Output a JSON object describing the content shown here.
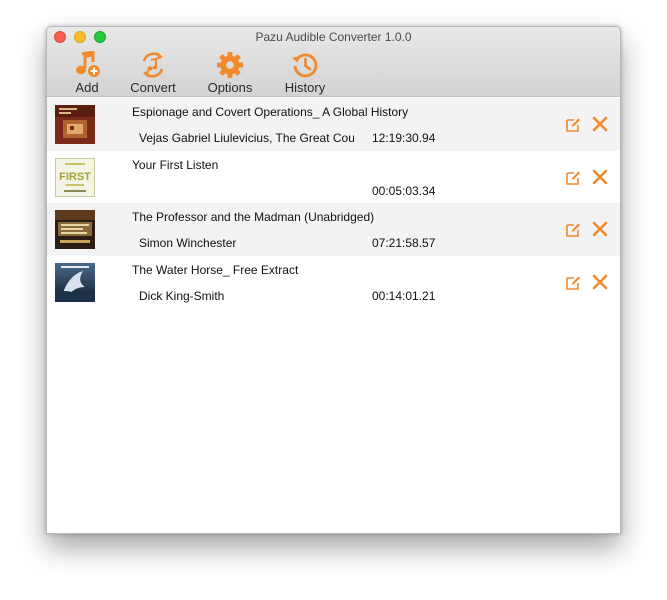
{
  "window": {
    "title": "Pazu Audible Converter 1.0.0"
  },
  "colors": {
    "accent": "#f18a2c",
    "row_alt": "#f3f3f3"
  },
  "toolbar": {
    "add_label": "Add",
    "convert_label": "Convert",
    "options_label": "Options",
    "history_label": "History"
  },
  "books": [
    {
      "title": "Espionage and Covert Operations_ A Global History",
      "author": "Vejas Gabriel Liulevicius, The Great Cours",
      "duration": "12:19:30.94",
      "cover": "brown-cover"
    },
    {
      "title": "Your First Listen",
      "author": "",
      "duration": "00:05:03.34",
      "cover": "first-listen-cover",
      "cover_text": "FIRST"
    },
    {
      "title": "The Professor and the Madman (Unabridged)",
      "author": "Simon Winchester",
      "duration": "07:21:58.57",
      "cover": "dark-cover"
    },
    {
      "title": "The Water Horse_ Free Extract",
      "author": "Dick King-Smith",
      "duration": "00:14:01.21",
      "cover": "water-horse-cover"
    }
  ],
  "icons": {
    "add": "add-music-icon",
    "convert": "convert-icon",
    "options": "gear-icon",
    "history": "history-icon",
    "edit": "edit-icon",
    "delete": "close-icon"
  }
}
